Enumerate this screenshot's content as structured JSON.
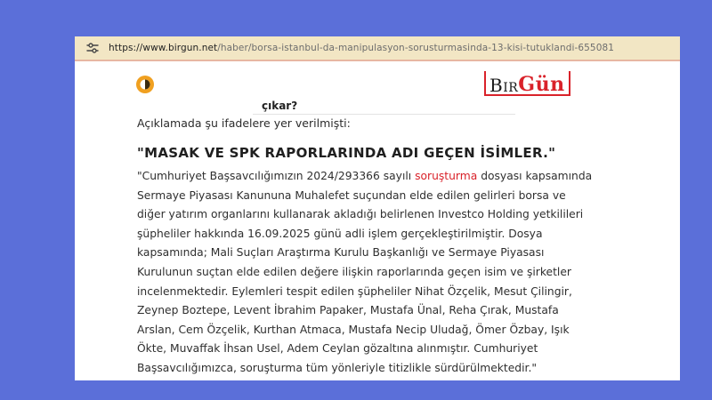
{
  "browser": {
    "url_host": "https://www.birgun.net",
    "url_path": "/haber/borsa-istanbul-da-manipulasyon-sorusturmasinda-13-kisi-tutuklandi-655081"
  },
  "site": {
    "logo_part1": "Bir",
    "logo_part2": "Gün"
  },
  "article": {
    "prev_fragment": "çıkar?",
    "intro": "Açıklamada şu ifadelere yer verilmişti:",
    "heading": "\"MASAK VE SPK RAPORLARINDA ADI GEÇEN İSİMLER.\"",
    "line1_before": "\"Cumhuriyet Başsavcılığımızın 2024/293366 sayılı ",
    "line1_link": "soruşturma",
    "line1_after": " dosyası kapsamında",
    "lines": [
      "Sermaye Piyasası Kanununa Muhalefet suçundan elde edilen gelirleri borsa ve",
      "diğer yatırım organlarını kullanarak akladığı belirlenen Investco Holding yetkilileri",
      "şüpheliler hakkında 16.09.2025 günü adli işlem gerçekleştirilmiştir. Dosya",
      "kapsamında; Mali Suçları Araştırma Kurulu Başkanlığı ve Sermaye Piyasası",
      "Kurulunun suçtan elde edilen değere ilişkin raporlarında geçen isim ve şirketler",
      "incelenmektedir. Eylemleri tespit edilen şüpheliler Nihat Özçelik, Mesut Çilingir,",
      "Zeynep Boztepe, Levent İbrahim Papaker, Mustafa Ünal, Reha Çırak, Mustafa",
      "Arslan, Cem Özçelik, Kurthan Atmaca, Mustafa Necip Uludağ, Ömer Özbay, Işık",
      "Ökte, Muvaffak İhsan Usel, Adem Ceylan gözaltına alınmıştır. Cumhuriyet",
      "Başsavcılığımızca, soruşturma tüm yönleriyle titizlikle sürdürülmektedir.\""
    ]
  },
  "colors": {
    "background": "#5b6fd9",
    "address_bar": "#f2e6c4",
    "brand_red": "#d9222a",
    "theme_icon": "#f0a020"
  },
  "icons": {
    "address": "tune-icon",
    "theme": "theme-toggle-icon"
  }
}
